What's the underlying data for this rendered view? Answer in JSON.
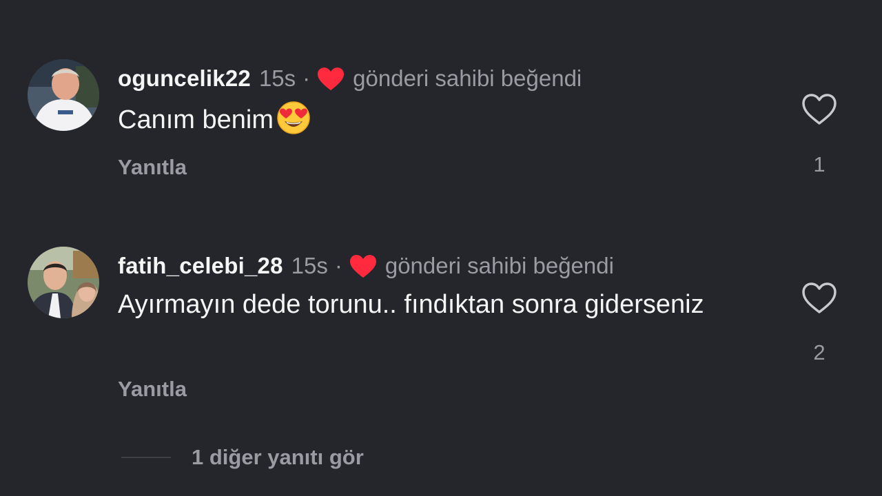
{
  "comments": [
    {
      "username": "oguncelik22",
      "time": "15s",
      "separator": "·",
      "liked_by_author_text": "gönderi sahibi beğendi",
      "text": "Canım benim",
      "emoji": "smiling-face-with-heart-eyes",
      "reply_label": "Yanıtla",
      "like_count": "1",
      "avatar_icon": "profile-photo-man-white-shirt"
    },
    {
      "username": "fatih_celebi_28",
      "time": "15s",
      "separator": "·",
      "liked_by_author_text": "gönderi sahibi beğendi",
      "text": "Ayırmayın dede torunu.. fındıktan sonra giderseniz",
      "reply_label": "Yanıtla",
      "like_count": "2",
      "avatar_icon": "profile-photo-couple"
    }
  ],
  "view_more_replies": "1 diğer yanıtı gör",
  "colors": {
    "background": "#25262c",
    "primary_text": "#f5f5f5",
    "secondary_text": "#9a9ca3",
    "liked_heart": "#ff2a3d",
    "like_outline": "#c8c9ce"
  },
  "icons": {
    "liked": "red-heart-icon",
    "like": "heart-outline-icon"
  }
}
